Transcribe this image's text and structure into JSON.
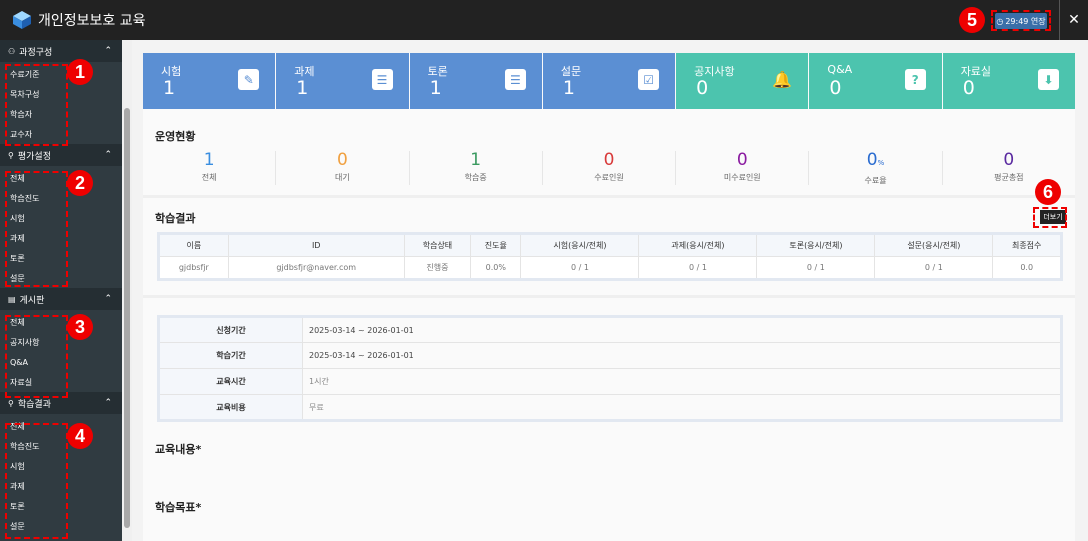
{
  "window": {
    "title": "개인정보보호 교육",
    "timer": "29:49 연장",
    "close": "✕"
  },
  "sidebar": {
    "sections": [
      {
        "title": "과정구성",
        "items": [
          "수료기준",
          "목차구성",
          "학습자",
          "교수자"
        ]
      },
      {
        "title": "평가설정",
        "items": [
          "전체",
          "학습진도",
          "시험",
          "과제",
          "토론",
          "설문"
        ]
      },
      {
        "title": "게시판",
        "items": [
          "전체",
          "공지사항",
          "Q&A",
          "자료실"
        ]
      },
      {
        "title": "학습결과",
        "items": [
          "전체",
          "학습진도",
          "시험",
          "과제",
          "토론",
          "설문"
        ]
      }
    ]
  },
  "tiles": [
    {
      "label": "시험",
      "value": "1",
      "icon": "✎"
    },
    {
      "label": "과제",
      "value": "1",
      "icon": "☰"
    },
    {
      "label": "토론",
      "value": "1",
      "icon": "☰"
    },
    {
      "label": "설문",
      "value": "1",
      "icon": "☑"
    },
    {
      "label": "공지사항",
      "value": "0",
      "icon": "🔔"
    },
    {
      "label": "Q&A",
      "value": "0",
      "icon": "?"
    },
    {
      "label": "자료실",
      "value": "0",
      "icon": "⬇"
    }
  ],
  "colors": {
    "blue_tile": "#5b8fd3",
    "teal_tile": "#4cc4ae"
  },
  "status": {
    "title": "운영현황",
    "stats": [
      {
        "value": "1",
        "label": "전체",
        "color": "#3a8ee0"
      },
      {
        "value": "0",
        "label": "대기",
        "color": "#f0a040"
      },
      {
        "value": "1",
        "label": "학습중",
        "color": "#3a9a60"
      },
      {
        "value": "0",
        "label": "수료인원",
        "color": "#d83a3a"
      },
      {
        "value": "0",
        "label": "미수료인원",
        "color": "#8a1aa0"
      },
      {
        "value": "0",
        "unit": "%",
        "label": "수료율",
        "color": "#2a6cd0"
      },
      {
        "value": "0",
        "label": "평균총점",
        "color": "#5a2aa0"
      }
    ]
  },
  "results": {
    "title": "학습결과",
    "more": "더보기",
    "headers": [
      "이름",
      "ID",
      "학습상태",
      "진도율",
      "시험(응시/전체)",
      "과제(응시/전체)",
      "토론(응시/전체)",
      "설문(응시/전체)",
      "최종점수"
    ],
    "rows": [
      [
        "gjdbsfjr",
        "gjdbsfjr@naver.com",
        "진행중",
        "0.0%",
        "0 / 1",
        "0 / 1",
        "0 / 1",
        "0 / 1",
        "0.0"
      ]
    ]
  },
  "info": [
    {
      "label": "신청기간",
      "value": "2025-03-14 ~ 2026-01-01"
    },
    {
      "label": "학습기간",
      "value": "2025-03-14 ~ 2026-01-01"
    },
    {
      "label": "교육시간",
      "value": "1시간"
    },
    {
      "label": "교육비용",
      "value": "무료"
    }
  ],
  "content_title": "교육내용*",
  "goal_title": "학습목표*",
  "annotations": [
    "1",
    "2",
    "3",
    "4",
    "5",
    "6"
  ]
}
